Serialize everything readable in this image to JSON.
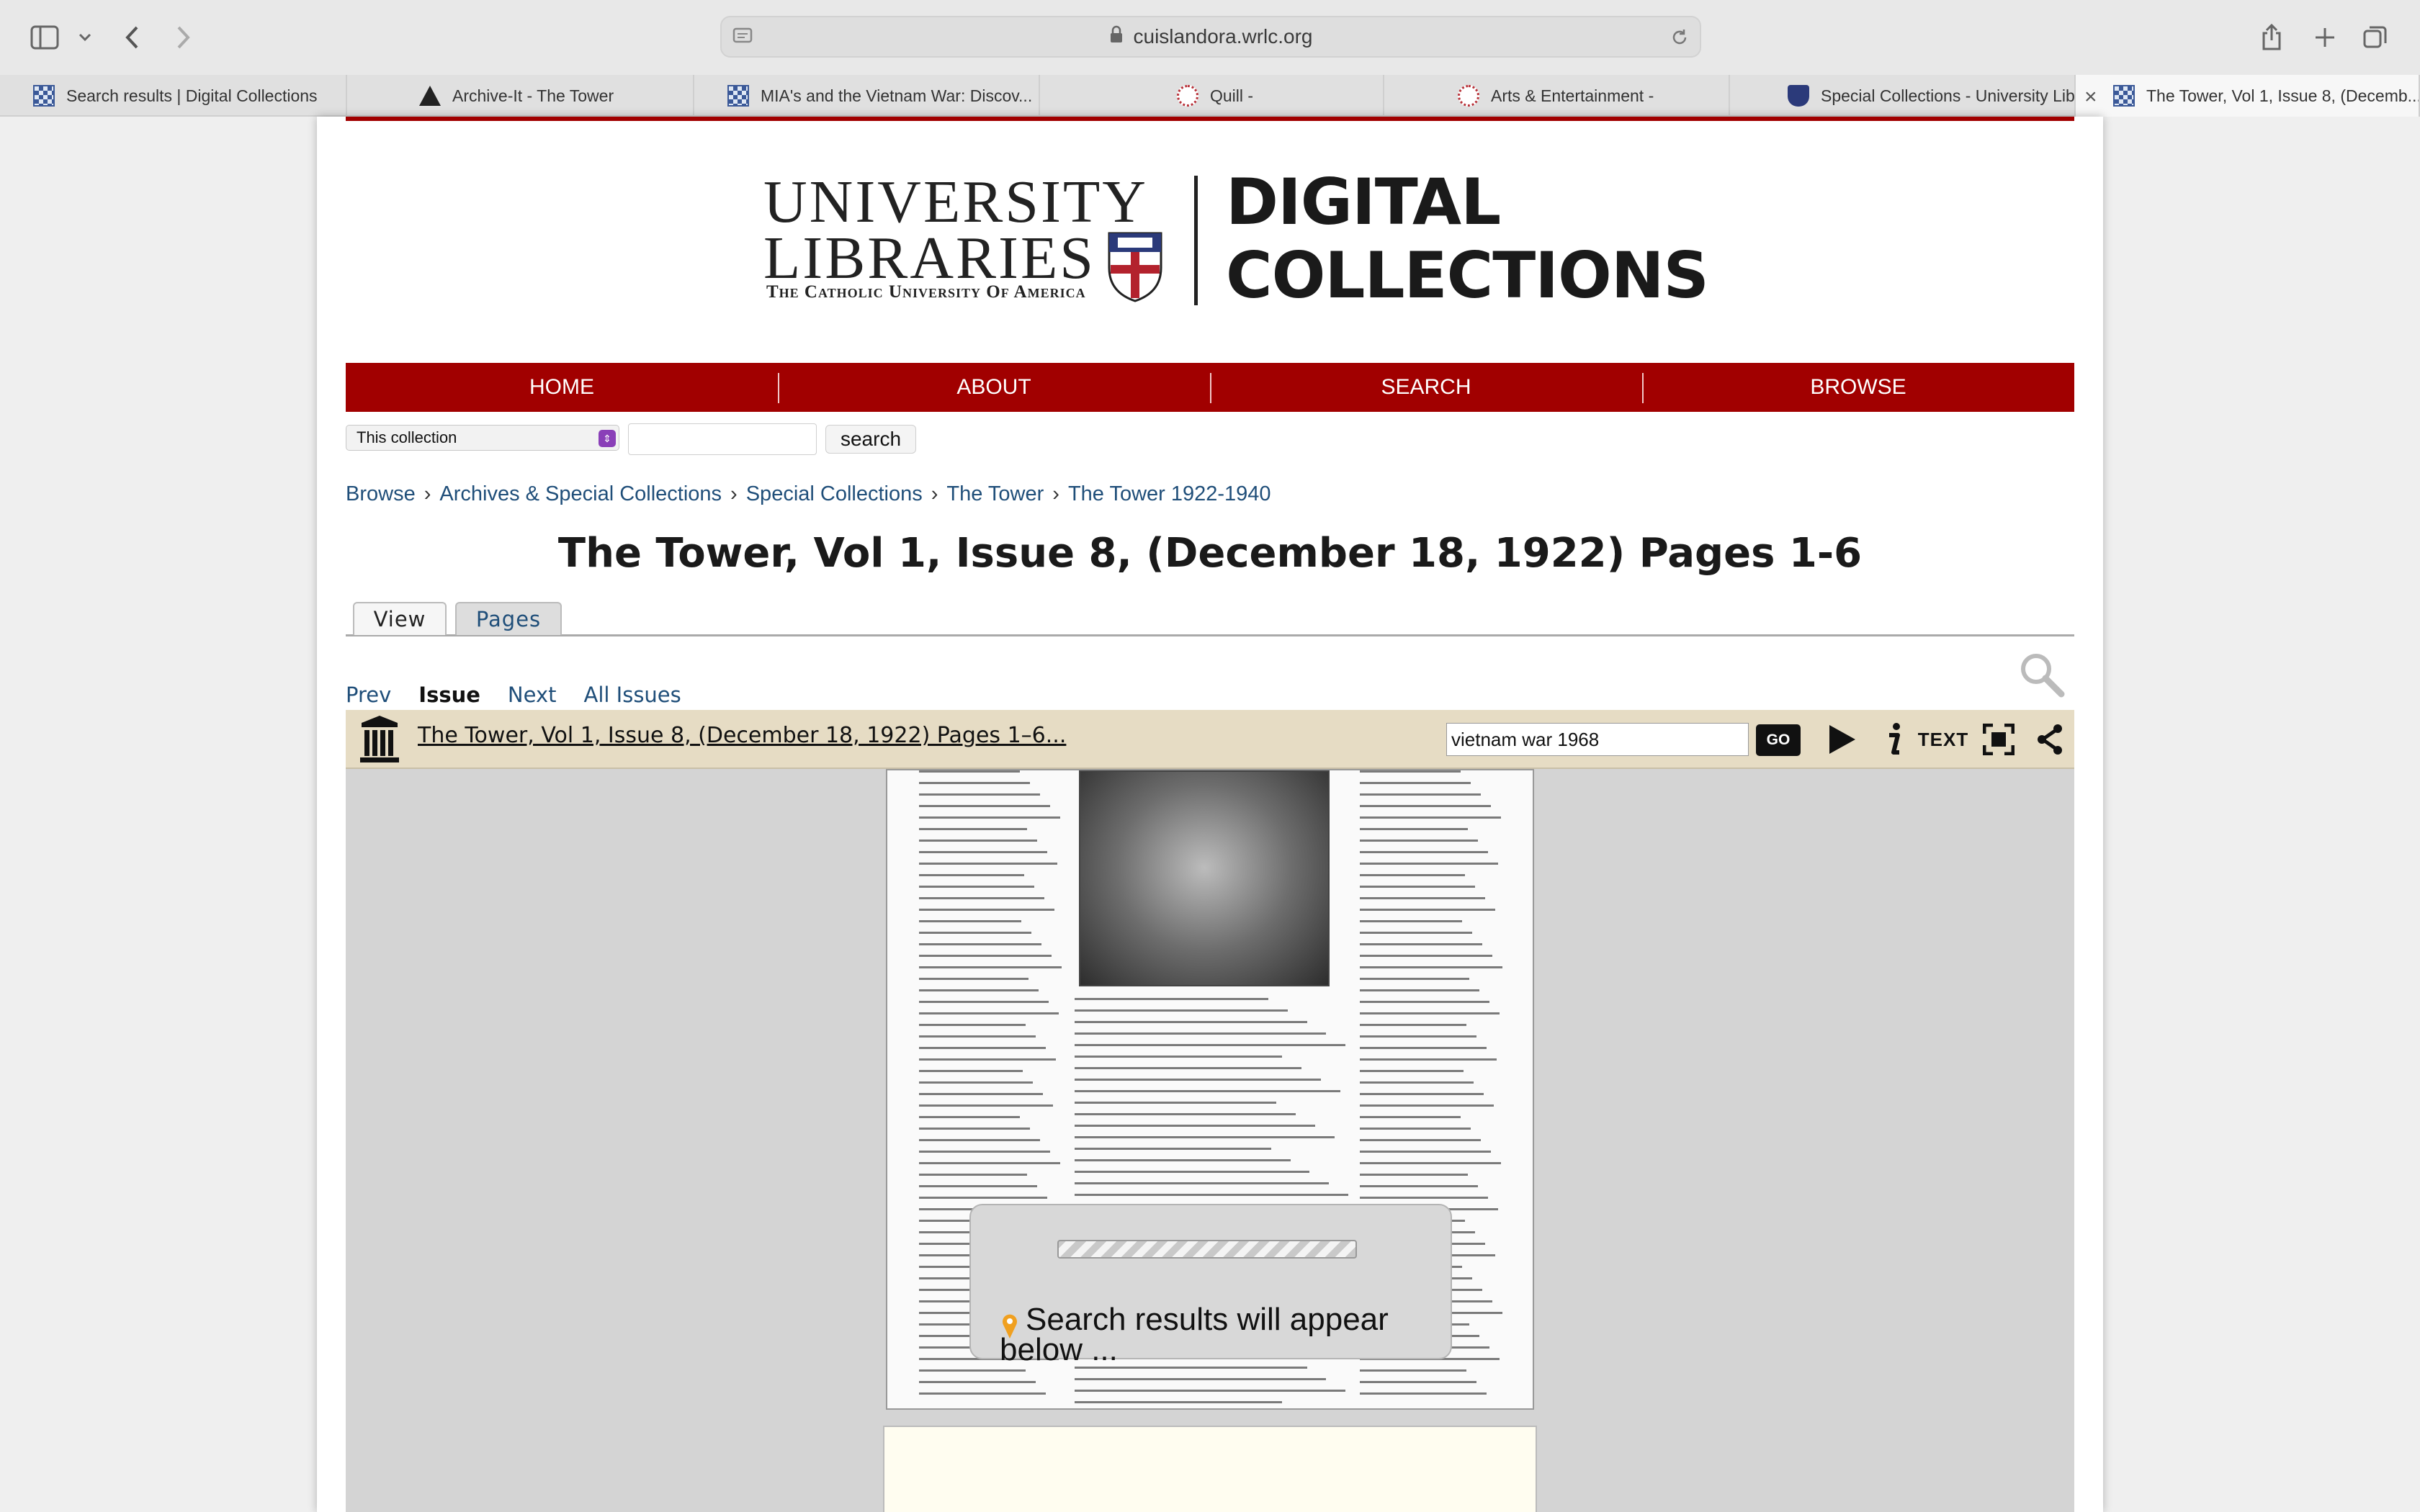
{
  "browser": {
    "url": "cuislandora.wrlc.org",
    "tabs": [
      {
        "label": "Search results | Digital Collections",
        "icon": "grid-favicon"
      },
      {
        "label": "Archive-It - The Tower",
        "icon": "archive-it-favicon"
      },
      {
        "label": "MIA's and the Vietnam War: Discov...",
        "icon": "grid-favicon"
      },
      {
        "label": "Quill -",
        "icon": "circle-favicon"
      },
      {
        "label": "Arts & Entertainment -",
        "icon": "circle-favicon"
      },
      {
        "label": "Special Collections - University Lib...",
        "icon": "shield-favicon"
      },
      {
        "label": "The Tower, Vol 1, Issue 8, (Decemb...",
        "icon": "grid-favicon",
        "active": true
      }
    ],
    "close_glyph": "×"
  },
  "logo": {
    "line1": "UNIVERSITY",
    "line2": "LIBRARIES",
    "line3": "The Catholic University Of America",
    "right1": "DIGITAL",
    "right2": "COLLECTIONS"
  },
  "nav": {
    "home": "HOME",
    "about": "ABOUT",
    "search": "SEARCH",
    "browse": "BROWSE"
  },
  "search": {
    "scope": "This collection",
    "query": "",
    "button": "search"
  },
  "breadcrumb": [
    "Browse",
    "Archives & Special Collections",
    "Special Collections",
    "The Tower",
    "The Tower 1922-1940"
  ],
  "breadcrumb_sep": "›",
  "page_title": "The Tower, Vol 1, Issue 8, (December 18, 1922) Pages 1-6",
  "tabs": {
    "view": "View",
    "pages": "Pages"
  },
  "issue_nav": {
    "prev": "Prev",
    "issue": "Issue",
    "next": "Next",
    "all": "All Issues"
  },
  "bookreader": {
    "title": "The Tower, Vol 1, Issue 8, (December 18, 1922) Pages 1–6...",
    "search_value": "vietnam war 1968",
    "go": "GO",
    "text_label": "TEXT",
    "popup_text": "Search results will appear below ..."
  },
  "colors": {
    "brand_red": "#a10000",
    "link_blue": "#1f4e79",
    "bar_tan": "#e6dcc4"
  }
}
